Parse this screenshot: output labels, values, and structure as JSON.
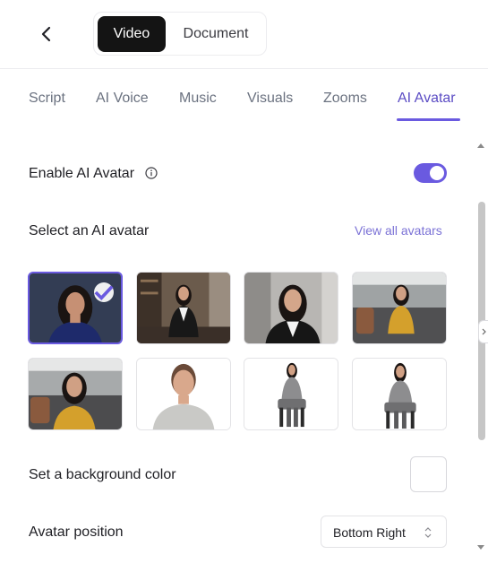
{
  "header": {
    "back_icon": "chevron-left-icon",
    "segments": [
      "Video",
      "Document"
    ],
    "active_segment": "Video"
  },
  "tabs": {
    "items": [
      "Script",
      "AI Voice",
      "Music",
      "Visuals",
      "Zooms",
      "AI Avatar"
    ],
    "active": "AI Avatar"
  },
  "avatar_settings": {
    "enable_label": "Enable AI Avatar",
    "enable_info_icon": "info-icon",
    "enabled": true,
    "select_label": "Select an AI avatar",
    "view_all_link": "View all avatars",
    "selected_index": 0,
    "avatars_count_note": "",
    "background_label": "Set a background color",
    "background_color": "#ffffff",
    "position_label": "Avatar position",
    "position_value": "Bottom Right"
  },
  "colors": {
    "accent": "#6a5ae0",
    "tab_active": "#5b4cc4",
    "link": "#7b72d6",
    "dark_button": "#141414"
  }
}
